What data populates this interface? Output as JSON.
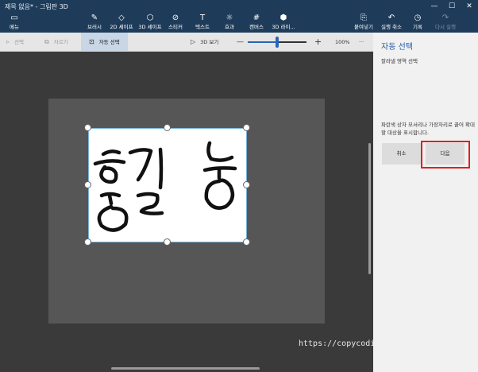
{
  "window": {
    "title": "제목 없음* - 그림판 3D",
    "controls": [
      "—",
      "☐",
      "✕"
    ]
  },
  "ribbon": {
    "menu": {
      "label": "메뉴",
      "icon": "folder-icon"
    },
    "tools": [
      {
        "label": "브러시",
        "icon": "brush-icon"
      },
      {
        "label": "2D 셰이프",
        "icon": "2d-shapes-icon"
      },
      {
        "label": "3D 셰이프",
        "icon": "3d-shapes-icon"
      },
      {
        "label": "스티커",
        "icon": "sticker-icon"
      },
      {
        "label": "텍스트",
        "icon": "text-icon"
      },
      {
        "label": "효과",
        "icon": "effects-icon"
      },
      {
        "label": "캔버스",
        "icon": "canvas-icon"
      },
      {
        "label": "3D 라이...",
        "icon": "3d-library-icon"
      }
    ],
    "actions": [
      {
        "label": "붙여넣기",
        "icon": "paste-icon"
      },
      {
        "label": "실행 취소",
        "icon": "undo-icon"
      },
      {
        "label": "기록",
        "icon": "history-icon"
      },
      {
        "label": "다시 실행",
        "icon": "redo-icon"
      }
    ]
  },
  "toolbar": {
    "select": "선택",
    "crop": "자르기",
    "magic_select": "자동 선택",
    "view_3d": "3D 보기",
    "zoom_minus": "—",
    "zoom_plus": "+",
    "zoom": "100%",
    "more": "···"
  },
  "zoom_level": 0.5,
  "panel": {
    "title": "자동 선택",
    "subtitle": "잘라낼 영역 선택",
    "description": "파란색 상자 모서리나 가장자리로 끌어 확대할 대상을 표시합니다.",
    "cancel": "취소",
    "next": "다음"
  },
  "watermark": "https://copycoding.tistory.com/",
  "colors": {
    "ribbon": "#1e3c5a",
    "accent": "#2a5ca8",
    "highlight": "#e02020"
  }
}
